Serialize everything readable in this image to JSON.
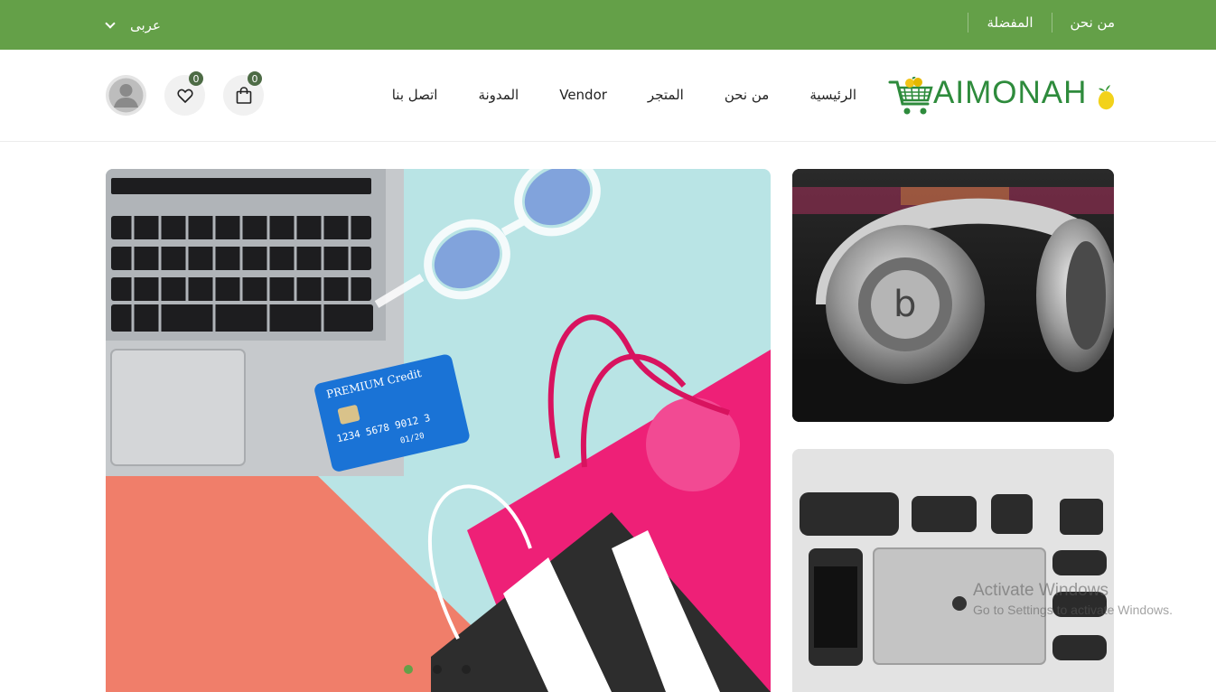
{
  "topbar": {
    "links": [
      "من نحن",
      "المفضلة"
    ],
    "language": "عربى",
    "color": "#64a048"
  },
  "header": {
    "logo_text": "AIMONAH",
    "nav": [
      "الرئيسية",
      "من نحن",
      "المتجر",
      "Vendor",
      "المدونة",
      "اتصل بنا"
    ],
    "cart_count": "0",
    "wishlist_count": "0",
    "icons": [
      "bag-icon",
      "heart-icon",
      "user-avatar"
    ]
  },
  "slider": {
    "dots": 3,
    "active_dot": 0,
    "hero_subject": "laptop, credit card, glasses and shopping bags"
  },
  "watermark": {
    "line1": "Activate Windows",
    "line2": "Go to Settings to activate Windows."
  }
}
